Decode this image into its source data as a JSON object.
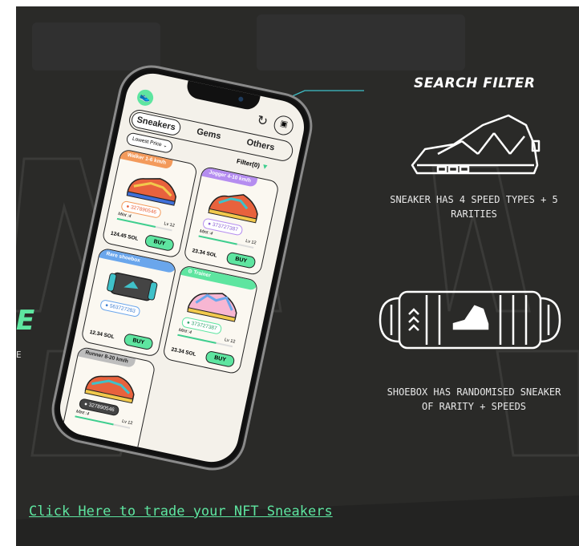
{
  "left_edge": {
    "big_letter": "E",
    "small_letter": "E"
  },
  "phone": {
    "tabs": [
      "Sneakers",
      "Gems",
      "Others"
    ],
    "sort_label": "Lowest Price",
    "filter_label": "Filter(0)",
    "cards": [
      {
        "tag": "Walker",
        "tag_speed": "1-6 km/h",
        "serial": "327890546",
        "mint": "Mint :4",
        "level": "Lv 12",
        "price": "124.45 SOL",
        "buy": "BUY"
      },
      {
        "tag": "Jogger",
        "tag_speed": "4-10 km/h",
        "serial": "373727387",
        "mint": "Mint :4",
        "level": "Lv 12",
        "price": "23.34 SOL",
        "buy": "BUY"
      },
      {
        "tag": "Rare shoebox",
        "tag_speed": "",
        "serial": "563727283",
        "mint": "",
        "level": "",
        "price": "12.34 SOL",
        "buy": "BUY"
      },
      {
        "tag": "Trainer",
        "tag_speed": "",
        "serial": "373727387",
        "mint": "Mint :4",
        "level": "Lv 12",
        "price": "23.34 SOL",
        "buy": "BUY"
      },
      {
        "tag": "Runner",
        "tag_speed": "8-20 km/h",
        "serial": "327890546",
        "mint": "Mint :4",
        "level": "Lv 12",
        "price": "",
        "buy": ""
      }
    ]
  },
  "feature": {
    "heading": "SEARCH FILTER",
    "sneaker_text": "SNEAKER HAS 4 SPEED TYPES + 5 RARITIES",
    "shoebox_text": "SHOEBOX HAS RANDOMISED SNEAKER OF RARITY + SPEEDS"
  },
  "cta_link": "Click Here to trade your NFT Sneakers",
  "colors": {
    "accent": "#5ee5a0",
    "background": "#2a2a28",
    "line": "#3fc1c9"
  }
}
